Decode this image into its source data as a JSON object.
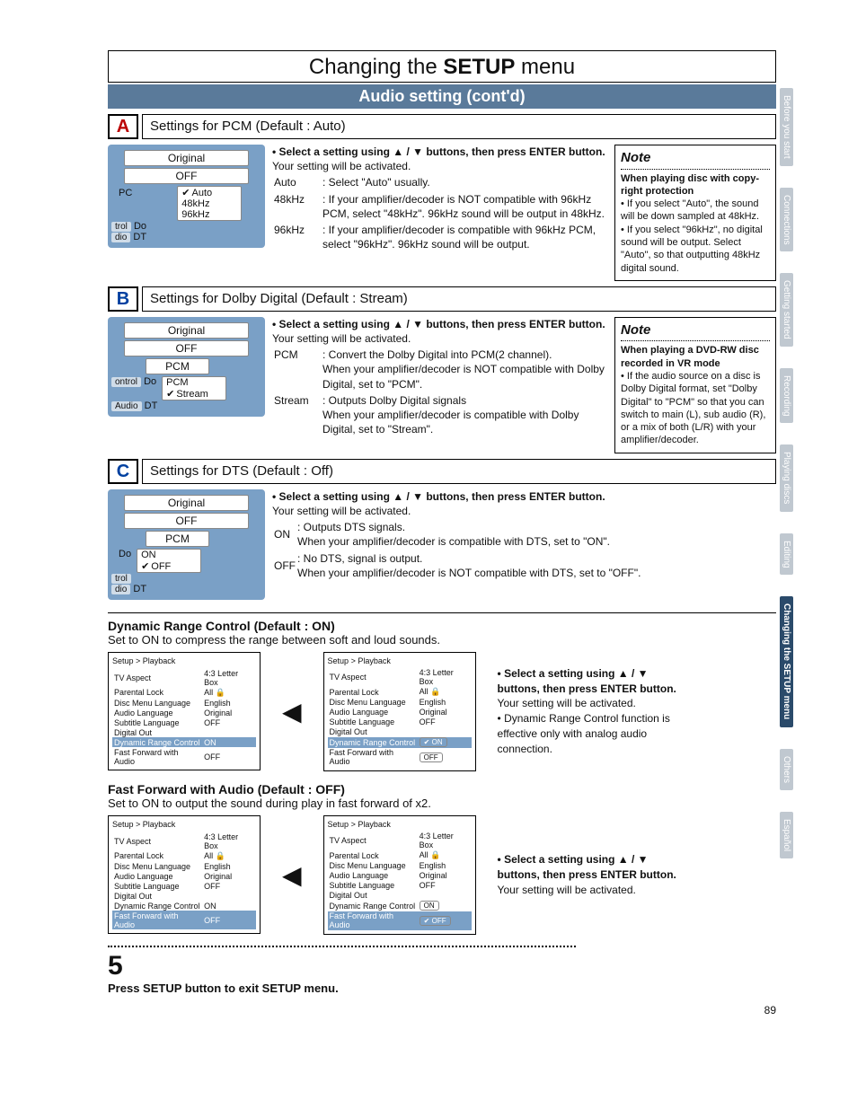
{
  "title_pre": "Changing the ",
  "title_bold": "SETUP",
  "title_post": " menu",
  "subtitle": "Audio setting (cont'd)",
  "page_number": "89",
  "tabs": [
    "Before you start",
    "Connections",
    "Getting started",
    "Recording",
    "Playing discs",
    "Editing",
    "Changing the SETUP menu",
    "Others",
    "Español"
  ],
  "sectionA": {
    "letter": "A",
    "title": "Settings for PCM (Default : Auto)",
    "osd": {
      "line1": "Original",
      "line2": "OFF",
      "row_pc": "PC",
      "opts": [
        "Auto",
        "48kHz",
        "96kHz"
      ],
      "sel": 0,
      "row_do": "Do",
      "row_dt": "DT",
      "side1": "trol",
      "side2": "dio"
    },
    "instr_bullet": "• Select a setting using ▲ / ▼ buttons, then press ENTER button.",
    "instr_body": "Your setting will be activated.",
    "kv": [
      [
        "Auto",
        ": Select \"Auto\" usually."
      ],
      [
        "48kHz",
        ": If your amplifier/decoder is NOT compatible with 96kHz PCM, select \"48kHz\". 96kHz sound will be output in 48kHz."
      ],
      [
        "96kHz",
        ": If your amplifier/decoder is compatible with 96kHz PCM, select \"96kHz\". 96kHz sound will be output."
      ]
    ],
    "note_h": "Note",
    "note_b1": "When playing disc with copy-right protection",
    "note_li": [
      "• If you select \"Auto\", the sound will be down sampled at 48kHz.",
      "• If you select \"96kHz\", no digital sound will be output. Select \"Auto\", so that outputting 48kHz digital sound."
    ]
  },
  "sectionB": {
    "letter": "B",
    "title": "Settings for Dolby Digital (Default : Stream)",
    "osd": {
      "line1": "Original",
      "line2": "OFF",
      "row_pcm": "PCM",
      "opts": [
        "PCM",
        "Stream"
      ],
      "sel": 1,
      "row_do": "Do",
      "row_dt": "DT",
      "side_ctrl": "ontrol",
      "side_audio": "Audio"
    },
    "instr_bullet": "• Select a setting using ▲ / ▼ buttons, then press ENTER button.",
    "instr_body": "Your setting will be activated.",
    "kv": [
      [
        "PCM",
        ": Convert the Dolby Digital into PCM(2 channel).\nWhen your amplifier/decoder is NOT compatible with Dolby Digital, set to \"PCM\"."
      ],
      [
        "Stream",
        ": Outputs Dolby Digital signals\nWhen your amplifier/decoder is compatible with Dolby Digital, set to \"Stream\"."
      ]
    ],
    "note_h": "Note",
    "note_b1": "When playing a DVD-RW disc recorded in VR mode",
    "note_li": [
      "• If the audio source on a disc is Dolby Digital format, set \"Dolby Digital\" to \"PCM\" so that you can switch to main (L), sub audio (R), or a mix of both (L/R) with your amplifier/decoder."
    ]
  },
  "sectionC": {
    "letter": "C",
    "title": "Settings for DTS (Default : Off)",
    "osd": {
      "line1": "Original",
      "line2": "OFF",
      "row_pcm": "PCM",
      "opts": [
        "ON",
        "OFF"
      ],
      "sel": 1,
      "row_do": "Do",
      "row_dt": "DT",
      "side1": "trol",
      "side2": "dio"
    },
    "instr_bullet": "• Select a setting using ▲ / ▼ buttons, then press ENTER button.",
    "instr_body": "Your setting will be activated.",
    "kv": [
      [
        "ON",
        ": Outputs DTS signals.\nWhen your amplifier/decoder is compatible with DTS, set to \"ON\"."
      ],
      [
        "OFF",
        ": No DTS, signal is output.\nWhen your amplifier/decoder is NOT compatible with DTS, set to \"OFF\"."
      ]
    ]
  },
  "drc": {
    "head": "Dynamic Range Control (Default : ON)",
    "desc": "Set to ON to compress the range between soft and loud sounds.",
    "menu_title": "Setup > Playback",
    "rows": [
      [
        "TV Aspect",
        "4:3 Letter Box"
      ],
      [
        "Parental Lock",
        "All  🔒"
      ],
      [
        "Disc Menu Language",
        "English"
      ],
      [
        "Audio Language",
        "Original"
      ],
      [
        "Subtitle Language",
        "OFF"
      ],
      [
        "Digital Out",
        ""
      ],
      [
        "Dynamic Range Control",
        "ON"
      ],
      [
        "Fast Forward with Audio",
        "OFF"
      ]
    ],
    "right_menu_pill_on": "✔ ON",
    "right_menu_pill_off": "OFF",
    "r_bullet": "• Select a setting using ▲ / ▼ buttons, then press ENTER button.",
    "r_body": "Your setting will be activated.\n• Dynamic Range Control function is effective only with analog audio connection."
  },
  "ffa": {
    "head": "Fast Forward with Audio (Default : OFF)",
    "desc": "Set to ON to output the sound during play in fast forward of x2.",
    "right_menu_pill_on": "ON",
    "right_menu_pill_off": "✔ OFF",
    "r_bullet": "• Select a setting using ▲ / ▼ buttons, then press ENTER button.",
    "r_body": "Your setting will be activated."
  },
  "step_number": "5",
  "exit_line": "Press SETUP button to exit SETUP menu."
}
